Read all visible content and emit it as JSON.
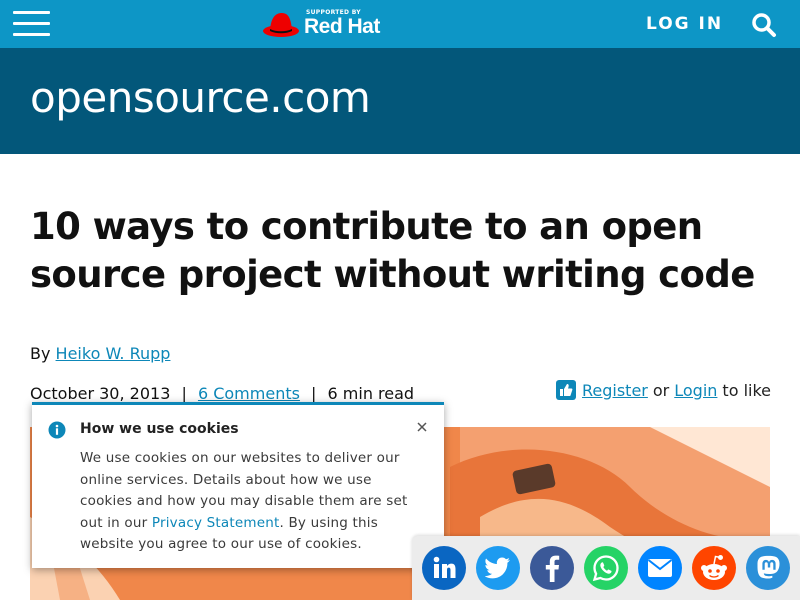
{
  "header": {
    "menu_icon": "hamburger-menu-icon",
    "sponsor_tagline": "SUPPORTED BY",
    "sponsor_name": "Red Hat",
    "login_label": "LOG IN",
    "search_icon": "search-icon",
    "colors": {
      "topbar": "#0d96c6",
      "brandbar": "#03577a",
      "redhat_red": "#ee0000"
    }
  },
  "site": {
    "logo_text": "opensource.com"
  },
  "article": {
    "title": "10 ways to contribute to an open source project without writing code",
    "byline_prefix": "By",
    "author": "Heiko W. Rupp",
    "date": "October 30, 2013",
    "separator": "|",
    "comments": "6 Comments",
    "read_time": "6 min read",
    "like": {
      "register": "Register",
      "or": "or",
      "login": "Login",
      "suffix": "to like"
    },
    "link_color": "#0d87b8"
  },
  "cookie_banner": {
    "title": "How we use cookies",
    "text_before_link": "We use cookies on our websites to deliver our online services. Details about how we use cookies and how you may disable them are set out in our ",
    "link_text": "Privacy Statement",
    "text_after_link": ". By using this website you agree to our use of cookies.",
    "info_icon": "info-icon",
    "close_icon": "close-icon"
  },
  "share": {
    "buttons": [
      {
        "name": "linkedin",
        "icon": "linkedin-icon",
        "color": "#0a66c2"
      },
      {
        "name": "twitter",
        "icon": "twitter-icon",
        "color": "#1d9bf0"
      },
      {
        "name": "facebook",
        "icon": "facebook-icon",
        "color": "#3b5998"
      },
      {
        "name": "whatsapp",
        "icon": "whatsapp-icon",
        "color": "#25d366"
      },
      {
        "name": "email",
        "icon": "email-icon",
        "color": "#0084ff"
      },
      {
        "name": "reddit",
        "icon": "reddit-icon",
        "color": "#ff4500"
      },
      {
        "name": "mastodon",
        "icon": "mastodon-icon",
        "color": "#2b90d9"
      }
    ]
  }
}
